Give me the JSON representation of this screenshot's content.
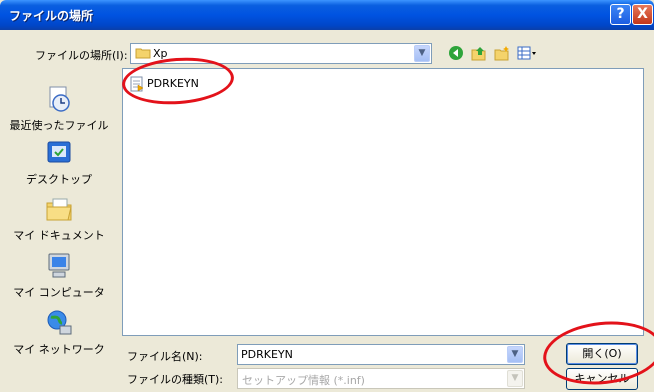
{
  "window": {
    "title": "ファイルの場所",
    "help_label": "?",
    "close_label": "X"
  },
  "lookin": {
    "label": "ファイルの場所(I):",
    "value": "Xp"
  },
  "places": [
    {
      "label": "最近使ったファイル",
      "icon": "recent-documents-icon"
    },
    {
      "label": "デスクトップ",
      "icon": "desktop-icon"
    },
    {
      "label": "マイ ドキュメント",
      "icon": "my-documents-icon"
    },
    {
      "label": "マイ コンピュータ",
      "icon": "my-computer-icon"
    },
    {
      "label": "マイ ネットワーク",
      "icon": "my-network-icon"
    }
  ],
  "files": [
    {
      "name": "PDRKEYN",
      "icon": "setup-info-file-icon"
    }
  ],
  "filename": {
    "label": "ファイル名(N):",
    "value": "PDRKEYN"
  },
  "filetype": {
    "label": "ファイルの種類(T):",
    "value": "セットアップ情報 (*.inf)"
  },
  "buttons": {
    "open": "開く(O)",
    "cancel": "キャンセル"
  },
  "colors": {
    "title_bar": "#0053e1",
    "dialog_bg": "#ece9d8",
    "annotation": "#e3121a"
  }
}
